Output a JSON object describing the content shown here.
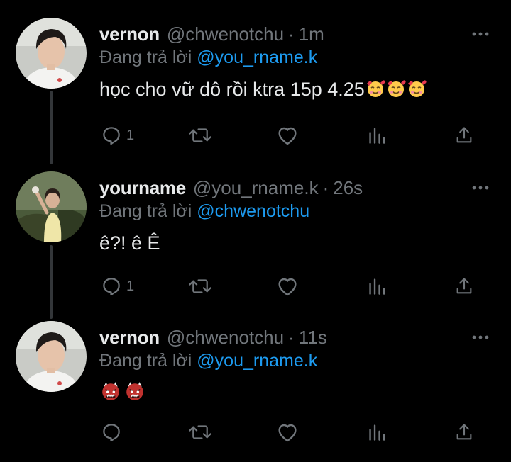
{
  "tweets": [
    {
      "name": "vernon",
      "handle": "@chwenotchu",
      "sep": "·",
      "time": "1m",
      "reply_prefix": "Đang trả lời",
      "reply_mention": "@you_rname.k",
      "text": "học cho vữ dô rồi ktra 15p 4.25",
      "emojis": [
        "smiling-face-with-hearts",
        "smiling-face-with-hearts",
        "smiling-face-with-hearts"
      ],
      "reply_count": "1"
    },
    {
      "name": "yourname",
      "handle": "@you_rname.k",
      "sep": "·",
      "time": "26s",
      "reply_prefix": "Đang trả lời",
      "reply_mention": "@chwenotchu",
      "text": "ê?! ê Ê",
      "emojis": [],
      "reply_count": "1"
    },
    {
      "name": "vernon",
      "handle": "@chwenotchu",
      "sep": "·",
      "time": "11s",
      "reply_prefix": "Đang trả lời",
      "reply_mention": "@you_rname.k",
      "text": "",
      "emojis": [
        "ogre",
        "ogre"
      ],
      "reply_count": ""
    }
  ],
  "icons": {
    "reply": "speech-bubble-icon",
    "retweet": "retweet-icon",
    "like": "heart-icon",
    "views": "bar-chart-icon",
    "share": "share-icon",
    "more": "more-dots-icon"
  },
  "colors": {
    "background": "#000000",
    "text": "#e7e9ea",
    "secondary": "#71767b",
    "mention": "#1d9bf0",
    "thread_line": "#333639"
  }
}
